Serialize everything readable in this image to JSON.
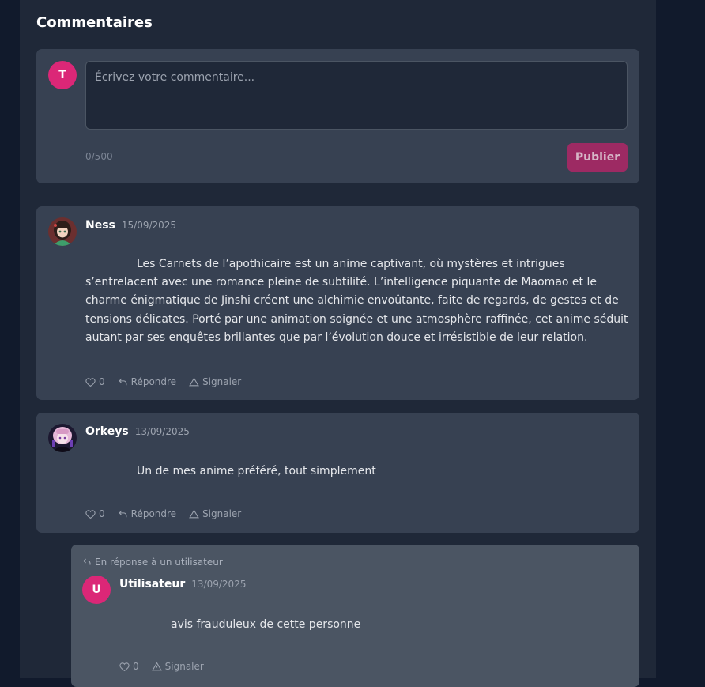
{
  "section_title": "Commentaires",
  "composer": {
    "avatar_letter": "T",
    "placeholder": "Écrivez votre commentaire...",
    "counter": "0/500",
    "publish_label": "Publier"
  },
  "comments": [
    {
      "author": "Ness",
      "date": "15/09/2025",
      "text": "Les Carnets de l’apothicaire est un anime captivant, où mystères et intrigues s’entrelacent avec une romance pleine de subtilité. L’intelligence piquante de Maomao et le charme énigmatique de Jinshi créent une alchimie envoûtante, faite de regards, de gestes et de tensions délicates. Porté par une animation soignée et une atmosphère raffinée, cet anime séduit autant par ses enquêtes brillantes que par l’évolution douce et irrésistible de leur relation.",
      "likes": "0",
      "reply_label": "Répondre",
      "report_label": "Signaler"
    },
    {
      "author": "Orkeys",
      "date": "13/09/2025",
      "text": "Un de mes anime préféré, tout simplement",
      "likes": "0",
      "reply_label": "Répondre",
      "report_label": "Signaler"
    }
  ],
  "reply": {
    "reply_to_label": "En réponse à un utilisateur",
    "avatar_letter": "U",
    "author": "Utilisateur",
    "date": "13/09/2025",
    "text": "avis frauduleux de cette personne",
    "likes": "0",
    "report_label": "Signaler"
  }
}
